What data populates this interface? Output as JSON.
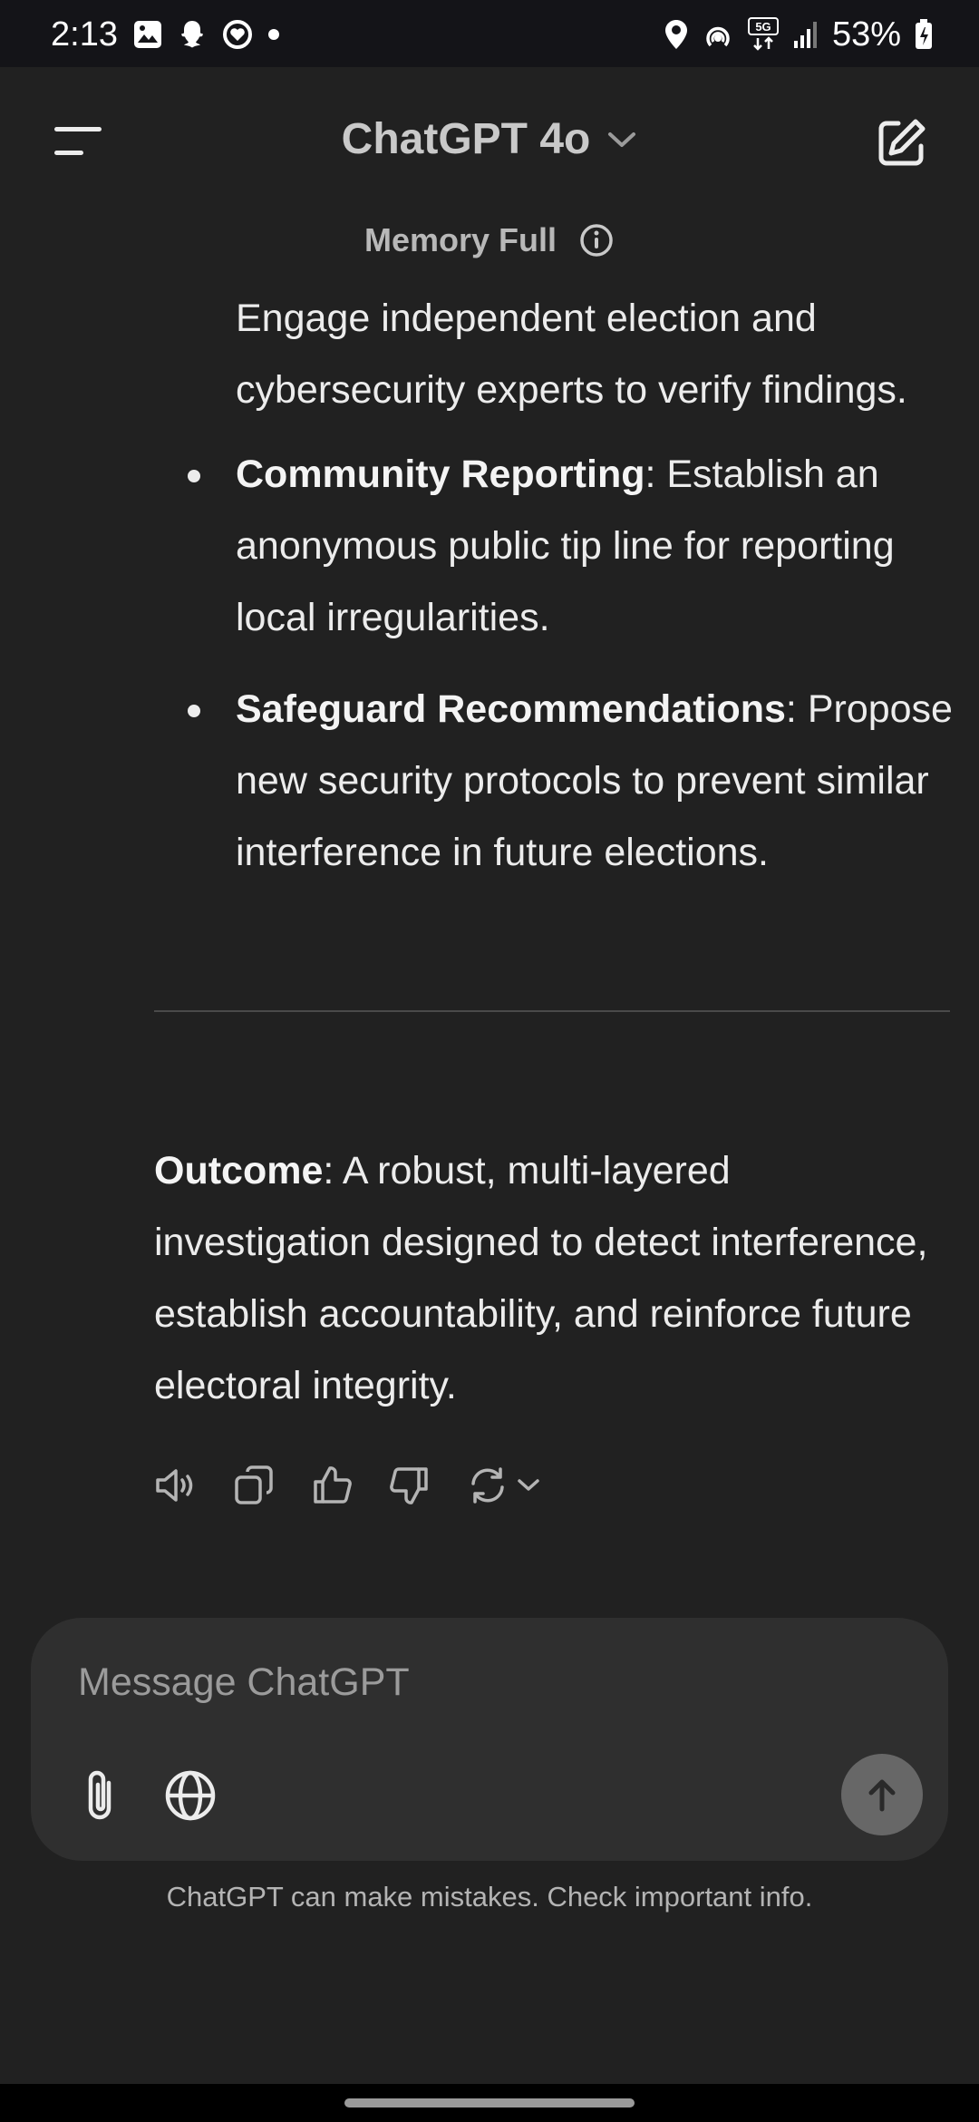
{
  "status_bar": {
    "time": "2:13",
    "battery": "53%",
    "network": "5G",
    "left_icons": [
      "gallery-icon",
      "snapchat-icon",
      "heart-circle-icon",
      "dot-icon"
    ],
    "right_icons": [
      "location-icon",
      "hotspot-icon",
      "network-5g-icon",
      "signal-icon",
      "battery-icon"
    ]
  },
  "header": {
    "title": "ChatGPT 4o",
    "menu_icon": "menu-icon",
    "new_chat_icon": "edit-icon"
  },
  "memory": {
    "label": "Memory Full",
    "icon": "info-icon"
  },
  "message": {
    "continued_text": "Engage independent election and cybersecurity experts to verify findings.",
    "bullets": [
      {
        "title": "Community Reporting",
        "text": ": Establish an anonymous public tip line for reporting local irregularities."
      },
      {
        "title": "Safeguard Recommendations",
        "text": ": Propose new security protocols to prevent similar interference in future elections."
      }
    ],
    "outcome_label": "Outcome",
    "outcome_text": ": A robust, multi-layered investigation designed to detect interference, establish accountability, and reinforce future electoral integrity."
  },
  "actions": [
    "read-aloud-icon",
    "copy-icon",
    "thumbs-up-icon",
    "thumbs-down-icon",
    "regenerate-icon"
  ],
  "composer": {
    "placeholder": "Message ChatGPT",
    "attach_icon": "paperclip-icon",
    "web_icon": "globe-icon",
    "send_icon": "arrow-up-icon"
  },
  "disclaimer": "ChatGPT can make mistakes. Check important info.",
  "colors": {
    "background": "#212121",
    "composer": "#2f2f2f",
    "text": "#ececec",
    "muted": "#b4b4b4"
  }
}
